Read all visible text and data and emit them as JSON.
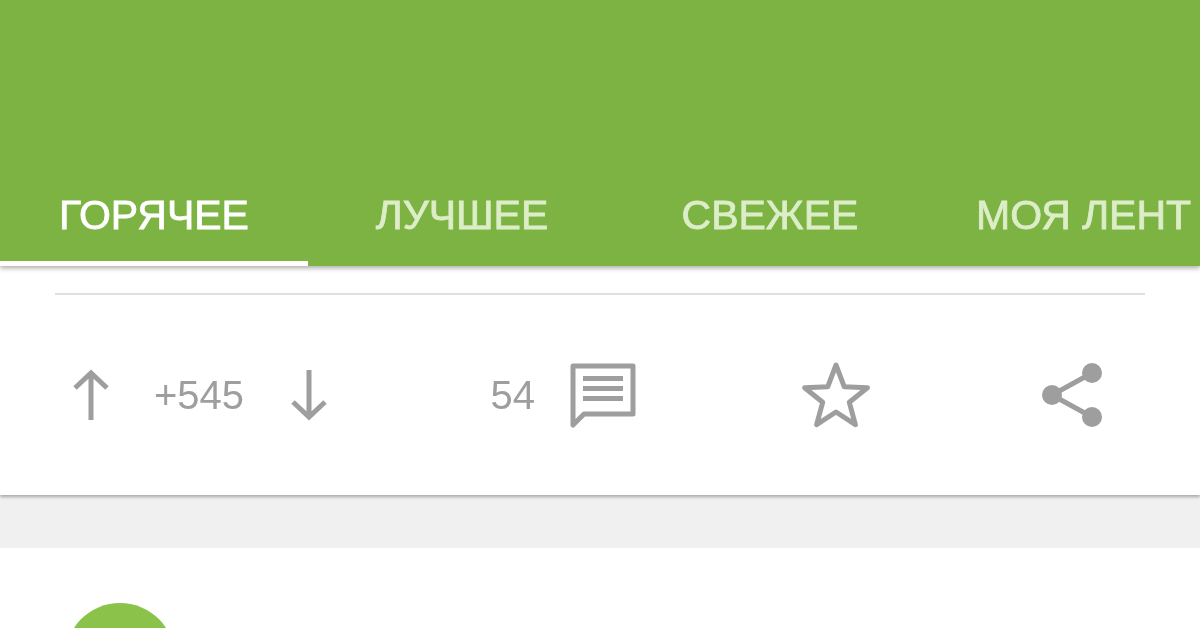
{
  "tabs": [
    {
      "label": "ГОРЯЧЕЕ",
      "selected": true
    },
    {
      "label": "ЛУЧШЕЕ",
      "selected": false
    },
    {
      "label": "СВЕЖЕЕ",
      "selected": false
    },
    {
      "label": "МОЯ ЛЕНТ",
      "selected": false
    }
  ],
  "post_actions": {
    "rating": "+545",
    "comments": "54",
    "saved": false
  }
}
